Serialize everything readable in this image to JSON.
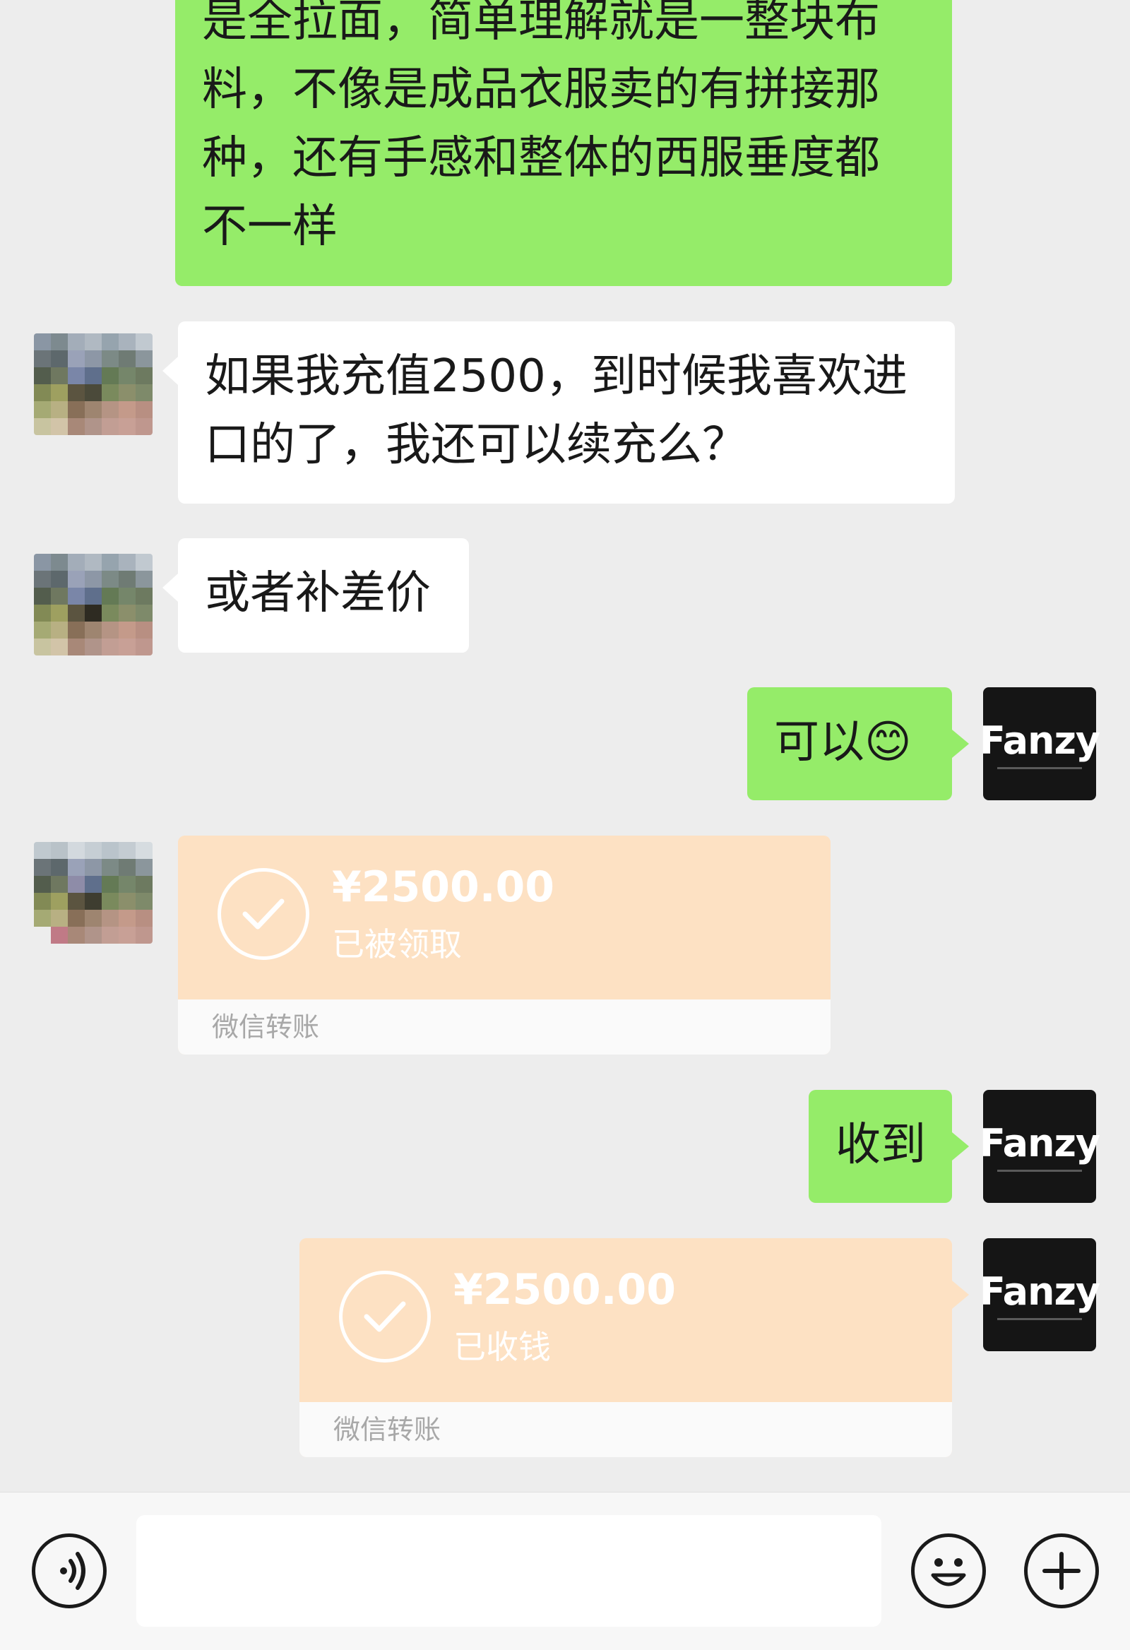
{
  "messages": {
    "msg1_text": "是全拉面，简单理解就是一整块布\n料，不像是成品衣服卖的有拼接那\n种，还有手感和整体的西服垂度都\n不一样",
    "msg2_text": "如果我充值2500，到时候我喜欢进\n口的了，我还可以续充么？",
    "msg3_text": "或者补差价",
    "msg4_text": "可以",
    "msg4_emoji": "😊",
    "msg5_text": "收到"
  },
  "transfers": {
    "incoming": {
      "amount": "¥2500.00",
      "status": "已被领取",
      "footer": "微信转账"
    },
    "outgoing": {
      "amount": "¥2500.00",
      "status": "已收钱",
      "footer": "微信转账"
    }
  },
  "avatars": {
    "self_brand": "Fanzy"
  },
  "icons": {
    "voice": "voice-icon",
    "emoji": "emoji-icon",
    "plus": "plus-icon",
    "check": "check-icon"
  },
  "colors": {
    "sent_bubble": "#95ec69",
    "received_bubble": "#ffffff",
    "transfer": "#fde1c3",
    "background": "#ededed"
  }
}
